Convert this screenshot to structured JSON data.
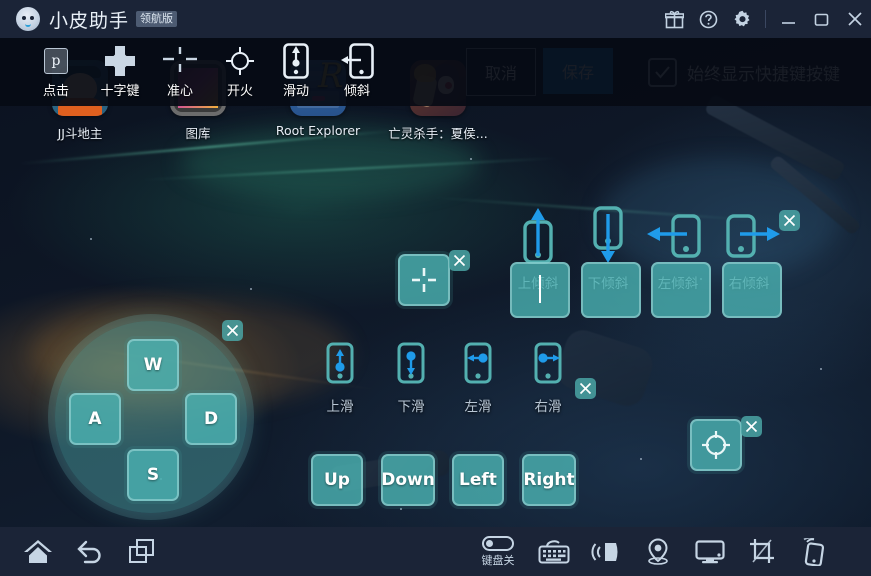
{
  "titlebar": {
    "app_name": "小皮助手",
    "edition_badge": "领航版",
    "icons": [
      "gift-icon",
      "help-icon",
      "gear-icon"
    ],
    "window_controls": [
      "minimize",
      "maximize",
      "close"
    ]
  },
  "desktop_icons": [
    {
      "label": "JJ斗地主",
      "icon": "jj-doudizhu-app-icon"
    },
    {
      "label": "图库",
      "icon": "gallery-app-icon"
    },
    {
      "label": "Root Explorer",
      "icon": "root-explorer-app-icon"
    },
    {
      "label": "亡灵杀手：夏侯...",
      "icon": "undead-slayer-app-icon"
    }
  ],
  "editor_toolbar": {
    "tools": [
      {
        "label": "点击",
        "icon": "tap-key-icon",
        "key_cap": "p"
      },
      {
        "label": "十字键",
        "icon": "dpad-icon"
      },
      {
        "label": "准心",
        "icon": "crosshair-icon"
      },
      {
        "label": "开火",
        "icon": "fire-icon"
      },
      {
        "label": "滑动",
        "icon": "swipe-icon"
      },
      {
        "label": "倾斜",
        "icon": "tilt-icon"
      }
    ],
    "cancel_label": "取消",
    "save_label": "保存",
    "checkbox_label": "始终显示快捷键按键",
    "checkbox_checked": true,
    "save_color": "#1892e0"
  },
  "overlay": {
    "dpad": {
      "keys": [
        {
          "label": "W",
          "pos": "up"
        },
        {
          "label": "A",
          "pos": "left"
        },
        {
          "label": "D",
          "pos": "right"
        },
        {
          "label": "S",
          "pos": "down"
        }
      ],
      "close_label": "×"
    },
    "crosshair_element": {
      "icon": "crosshair-icon",
      "close_label": "×"
    },
    "fire_element": {
      "icon": "fire-target-icon",
      "close_label": "×"
    },
    "tilt_group": {
      "close_label": "×",
      "items": [
        {
          "label": "上倾斜",
          "icon": "tilt-up-icon",
          "key": "",
          "focused": true
        },
        {
          "label": "下倾斜",
          "icon": "tilt-down-icon",
          "key": "",
          "focused": false
        },
        {
          "label": "左倾斜",
          "icon": "tilt-left-icon",
          "key": "",
          "focused": false
        },
        {
          "label": "右倾斜",
          "icon": "tilt-right-icon",
          "key": "",
          "focused": false
        }
      ]
    },
    "swipe_group": {
      "close_label": "×",
      "items": [
        {
          "label": "上滑",
          "icon": "swipe-up-icon",
          "key": "Up"
        },
        {
          "label": "下滑",
          "icon": "swipe-down-icon",
          "key": "Down"
        },
        {
          "label": "左滑",
          "icon": "swipe-left-icon",
          "key": "Left"
        },
        {
          "label": "右滑",
          "icon": "swipe-right-icon",
          "key": "Right"
        }
      ]
    },
    "accent_color": "#4ab1b1",
    "arrow_color": "#1f9bea"
  },
  "bottom_bar": {
    "left_icons": [
      "home-icon",
      "back-icon",
      "recent-apps-icon"
    ],
    "keyboard_toggle": {
      "label": "键盘关",
      "on": false
    },
    "right_icons": [
      "keyboard-icon",
      "volume-icon",
      "location-icon",
      "display-icon",
      "screenshot-icon",
      "shake-icon"
    ]
  }
}
